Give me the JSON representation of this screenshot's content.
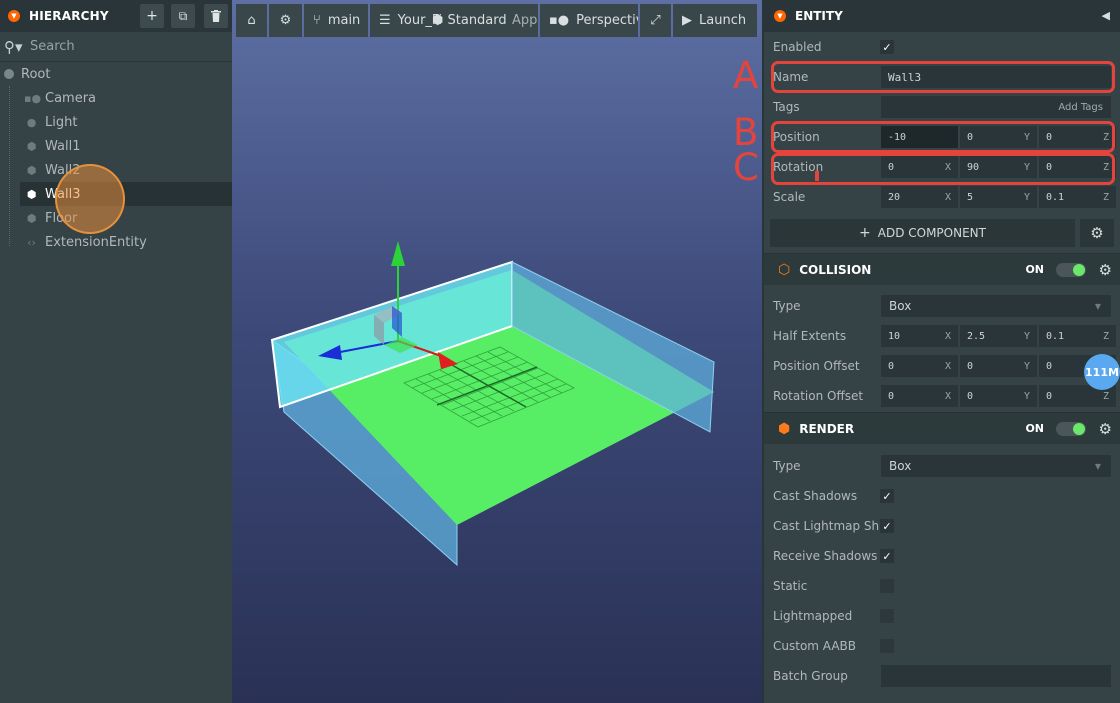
{
  "hierarchy": {
    "title": "HIERARCHY",
    "search_placeholder": "Search",
    "root_label": "Root",
    "items": [
      {
        "label": "Camera",
        "icon": "camera-icon"
      },
      {
        "label": "Light",
        "icon": "light-icon"
      },
      {
        "label": "Wall1",
        "icon": "entity-icon"
      },
      {
        "label": "Wall2",
        "icon": "entity-icon"
      },
      {
        "label": "Wall3",
        "icon": "entity-icon",
        "selected": true
      },
      {
        "label": "Floor",
        "icon": "entity-icon"
      },
      {
        "label": "ExtensionEntity",
        "icon": "code-icon"
      }
    ]
  },
  "toolbar": {
    "branch": "main",
    "scene_name": "Your_Fi",
    "scene_suffix": "App",
    "render_mode": "Standard",
    "camera": "Perspective",
    "launch": "Launch"
  },
  "entity": {
    "title": "ENTITY",
    "enabled_label": "Enabled",
    "name_label": "Name",
    "name_value": "Wall3",
    "tags_label": "Tags",
    "add_tags": "Add Tags",
    "position_label": "Position",
    "position": [
      "-10",
      "0",
      "0"
    ],
    "rotation_label": "Rotation",
    "rotation": [
      "0",
      "90",
      "0"
    ],
    "scale_label": "Scale",
    "scale": [
      "20",
      "5",
      "0.1"
    ],
    "axes": [
      "X",
      "Y",
      "Z"
    ],
    "add_component": "ADD COMPONENT"
  },
  "collision": {
    "title": "COLLISION",
    "on": "ON",
    "type_label": "Type",
    "type_value": "Box",
    "half_extents_label": "Half Extents",
    "half_extents": [
      "10",
      "2.5",
      "0.1"
    ],
    "position_offset_label": "Position Offset",
    "position_offset": [
      "0",
      "0",
      "0"
    ],
    "rotation_offset_label": "Rotation Offset",
    "rotation_offset": [
      "0",
      "0",
      "0"
    ]
  },
  "render": {
    "title": "RENDER",
    "on": "ON",
    "type_label": "Type",
    "type_value": "Box",
    "cast_shadows": "Cast Shadows",
    "cast_lightmap": "Cast Lightmap Sh...",
    "receive_shadows": "Receive Shadows",
    "static": "Static",
    "lightmapped": "Lightmapped",
    "custom_aabb": "Custom AABB",
    "batch_group": "Batch Group"
  },
  "annotations": {
    "a": "A",
    "b": "B",
    "c": "C"
  },
  "memory_badge": "111M",
  "colors": {
    "accent": "#ff6600",
    "annotation": "#e5443c",
    "toggle_on": "#6ae86a",
    "badge": "#5aa9f0"
  }
}
